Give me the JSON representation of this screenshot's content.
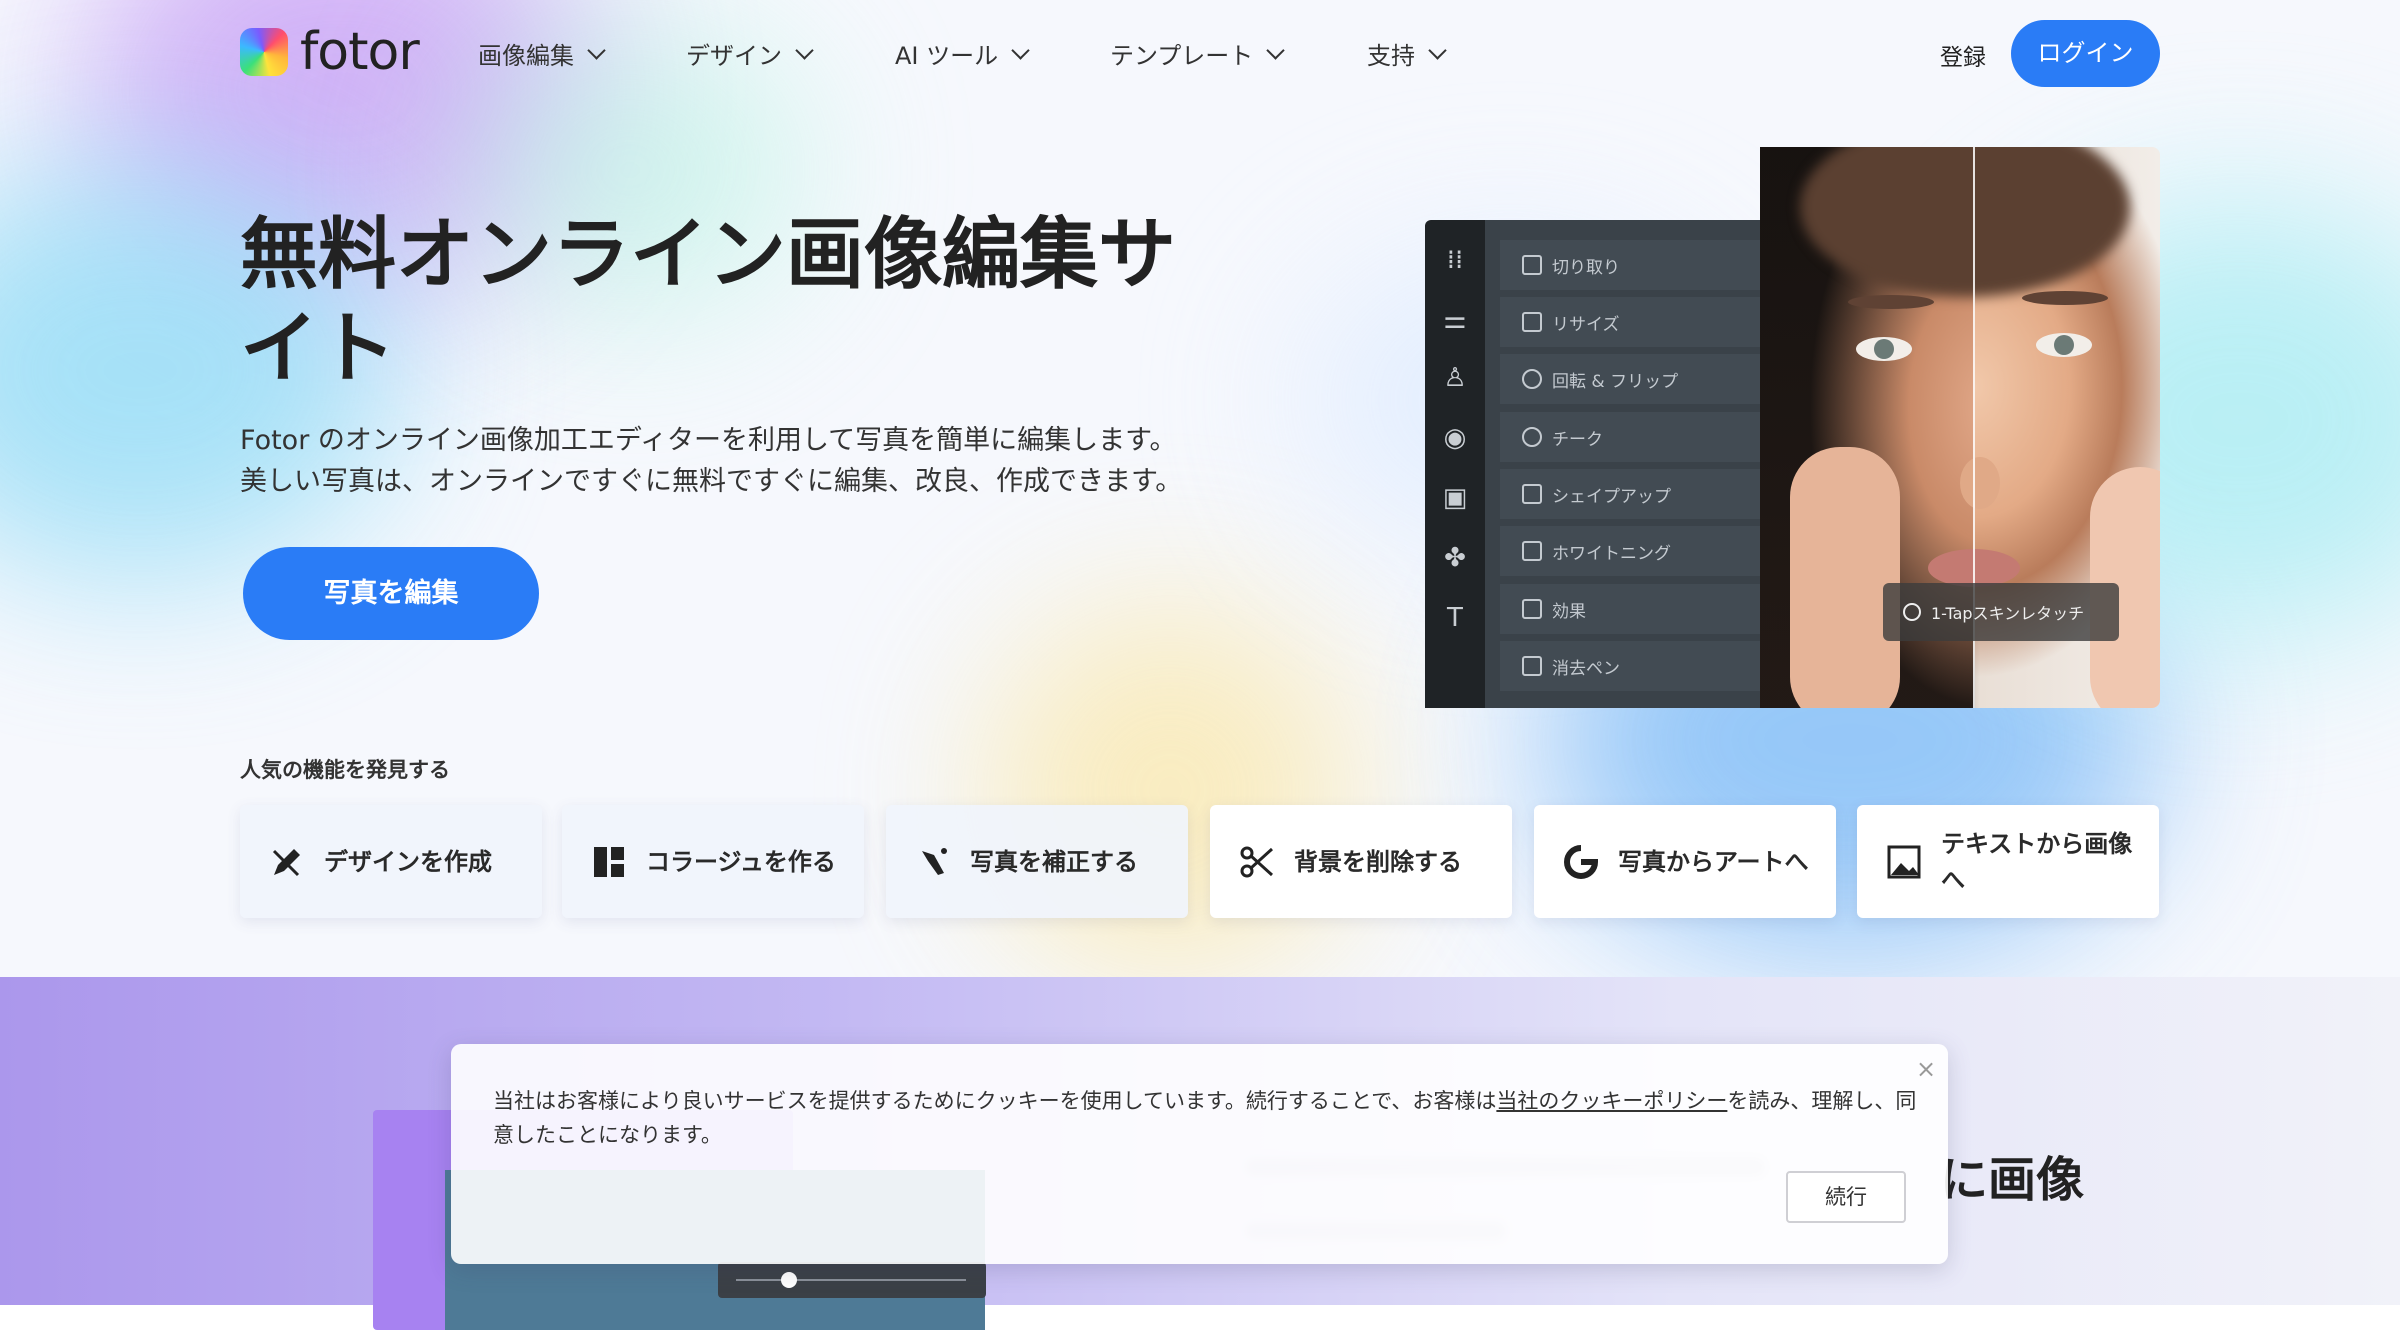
{
  "header": {
    "logo_text": "fotor",
    "nav": [
      {
        "label": "画像編集"
      },
      {
        "label": "デザイン"
      },
      {
        "label": "AI ツール"
      },
      {
        "label": "テンプレート"
      },
      {
        "label": "支持"
      }
    ],
    "register_label": "登録",
    "login_label": "ログイン"
  },
  "hero": {
    "title": "無料オンライン画像編集サイト",
    "description": "Fotor のオンライン画像加工エディターを利用して写真を簡単に編集します。 美しい写真は、オンラインですぐに無料ですぐに編集、改良、作成できます。",
    "cta_label": "写真を編集"
  },
  "editor_mock": {
    "menu_items": [
      {
        "label": "切り取り"
      },
      {
        "label": "リサイズ"
      },
      {
        "label": "回転 & フリップ"
      },
      {
        "label": "チーク"
      },
      {
        "label": "シェイプアップ"
      },
      {
        "label": "ホワイトニング"
      },
      {
        "label": "効果"
      },
      {
        "label": "消去ペン"
      }
    ],
    "skin_tag": "1-Tapスキンレタッチ",
    "rail_icons": [
      "grid-icon",
      "sliders-icon",
      "flask-icon",
      "eye-icon",
      "frame-icon",
      "elements-icon",
      "text-icon"
    ]
  },
  "features": {
    "label": "人気の機能を発見する",
    "items": [
      {
        "label": "デザインを作成",
        "icon": "design-pencil-icon"
      },
      {
        "label": "コラージュを作る",
        "icon": "collage-icon"
      },
      {
        "label": "写真を補正する",
        "icon": "magic-wand-icon"
      },
      {
        "label": "背景を削除する",
        "icon": "scissors-icon"
      },
      {
        "label": "写真からアートへ",
        "icon": "art-g-icon"
      },
      {
        "label": "テキストから画像へ",
        "icon": "ai-image-icon"
      }
    ]
  },
  "band": {
    "heading_fragment": "に画像"
  },
  "cookie": {
    "text_before": "当社はお客様により良いサービスを提供するためにクッキーを使用しています。続行することで、お客様は",
    "link": "当社のクッキーポリシー",
    "text_after": "を読み、理解し、同意したことになります。",
    "button_label": "続行",
    "close_symbol": "×"
  },
  "colors": {
    "accent": "#2a7cf6",
    "editor_dark": "#1f2326",
    "editor_menu": "#3a4249"
  }
}
